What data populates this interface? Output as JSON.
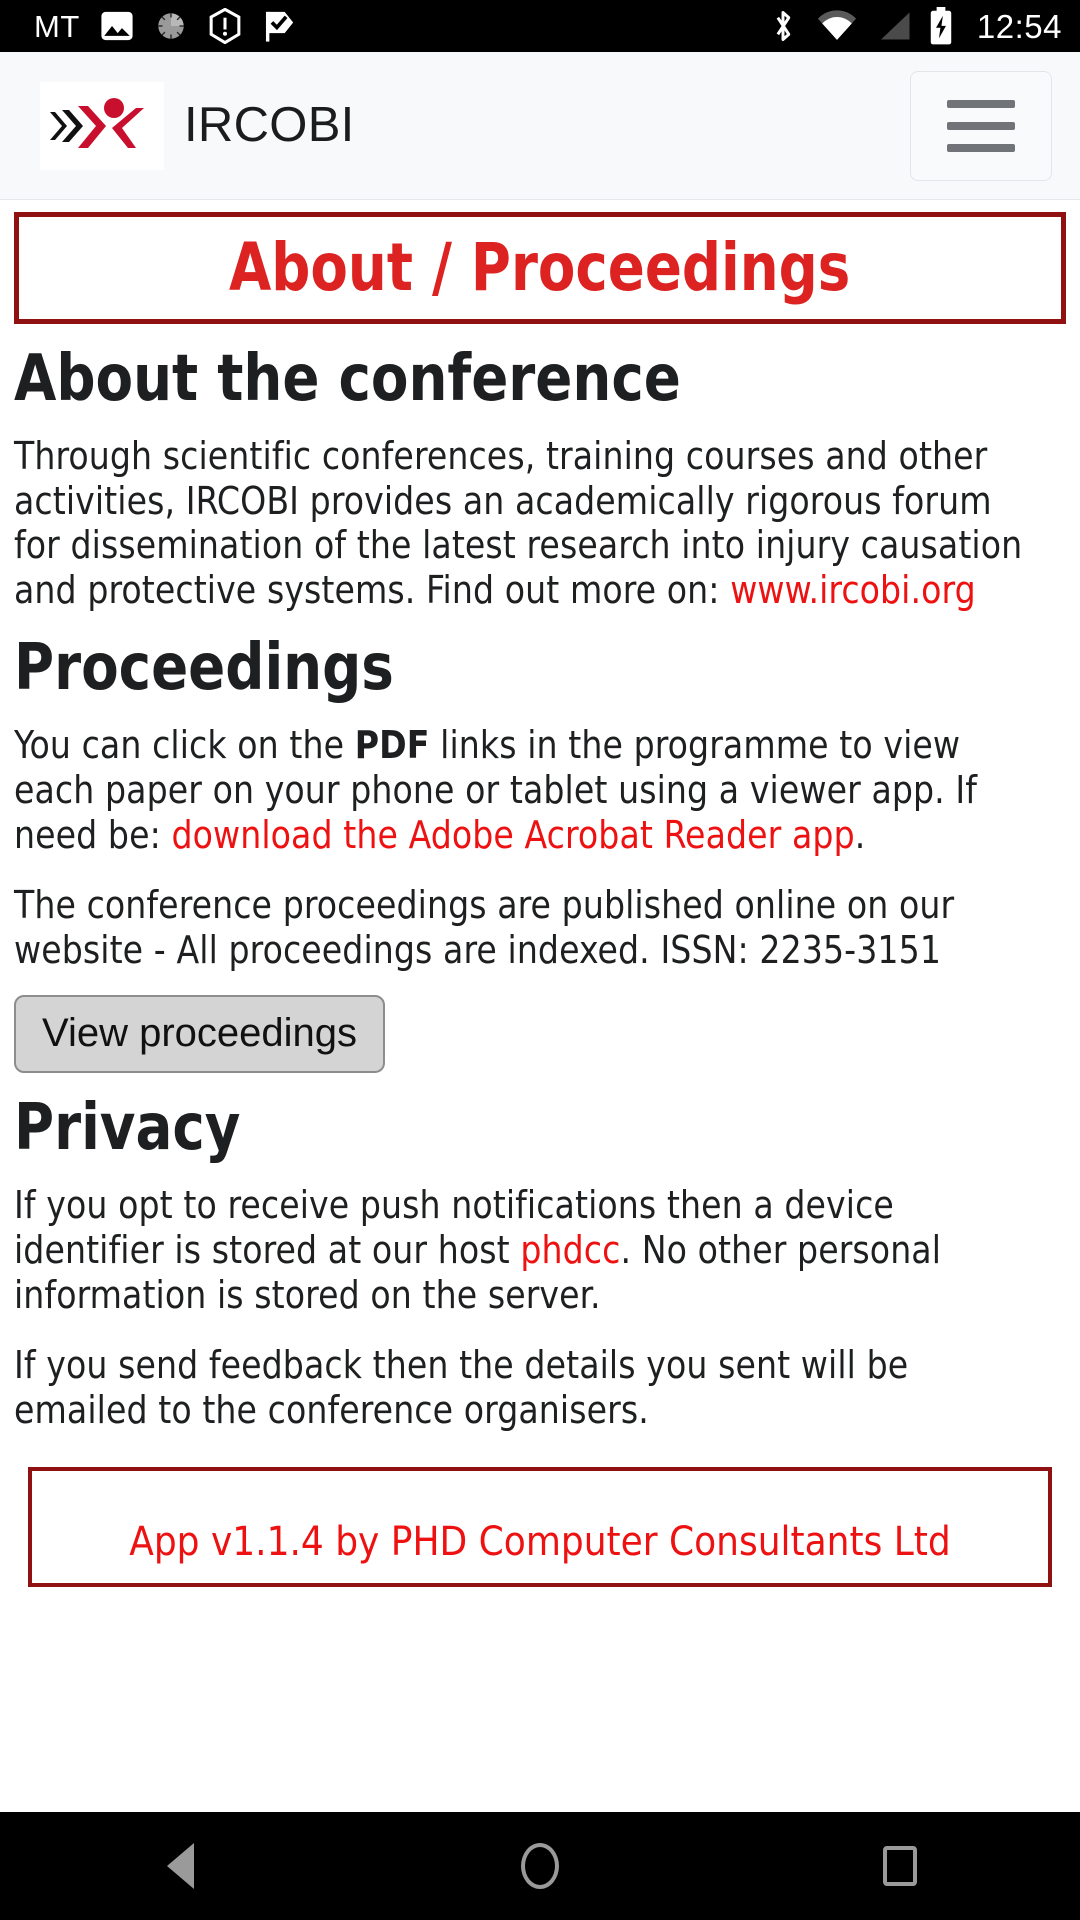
{
  "status_bar": {
    "carrier": "MT",
    "time": "12:54",
    "left_icons": [
      "image-icon",
      "sun-brightness-icon",
      "alert-shield-icon",
      "check-flag-icon"
    ],
    "right_icons": [
      "bluetooth-icon",
      "wifi-icon",
      "signal-icon",
      "battery-charging-icon"
    ],
    "background": "#000000"
  },
  "header": {
    "brand_name": "IRCOBI",
    "logo_name": "ircobi-logo",
    "menu_label": "menu",
    "background": "#f7f9fb"
  },
  "banner": {
    "title": "About / Proceedings",
    "border_color": "#8f1111",
    "text_color": "#dd2222"
  },
  "sections": {
    "about": {
      "heading": "About the conference",
      "paragraph_lead": "Through scientific conferences, training courses and other activities, IRCOBI provides an academically rigorous forum for dissemination of the latest research into injury causation and protective systems. Find out more on: ",
      "link_text": "www.ircobi.org"
    },
    "proceedings": {
      "heading": "Proceedings",
      "p1_before_bold": "You can click on the ",
      "p1_bold": "PDF",
      "p1_after_bold": " links in the programme to view each paper on your phone or tablet using a viewer app. If need be: ",
      "p1_link": "download the Adobe Acrobat Reader app",
      "p1_tail": ".",
      "p2": "The conference proceedings are published online on our website - All proceedings are indexed. ISSN: 2235-3151",
      "issn": "2235-3151",
      "button_label": "View proceedings"
    },
    "privacy": {
      "heading": "Privacy",
      "p1_before_link": "If you opt to receive push notifications then a device identifier is stored at our host ",
      "p1_link": "phdcc",
      "p1_after_link": ". No other personal information is stored on the server.",
      "p2": "If you send feedback then the details you sent will be emailed to the conference organisers."
    }
  },
  "footer": {
    "text": "App v1.1.4 by PHD Computer Consultants Ltd",
    "border_color": "#8f1111",
    "text_color": "#ee1111"
  },
  "nav_bar": {
    "back_label": "Back",
    "home_label": "Home",
    "recents_label": "Recents",
    "background": "#000000"
  },
  "colors": {
    "link_red": "#ee1111",
    "brand_red": "#c8102e",
    "dark_red": "#8f1111",
    "text": "#1d1f20"
  }
}
